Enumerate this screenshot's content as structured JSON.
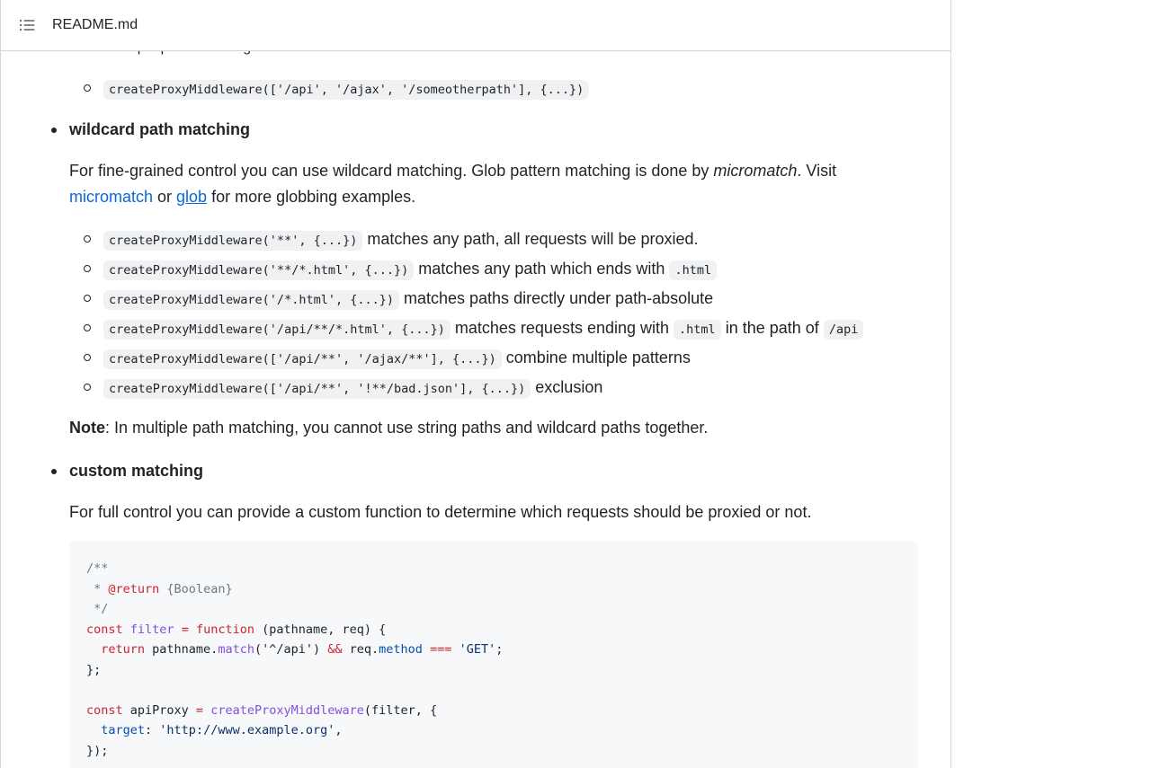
{
  "header": {
    "file_name": "README.md",
    "toc_icon": "list-unordered-icon"
  },
  "top_partial": {
    "text": "multiple path matching"
  },
  "top_item": {
    "code": "createProxyMiddleware(['/api', '/ajax', '/someotherpath'], {...})"
  },
  "wildcard": {
    "heading": "wildcard path matching",
    "para_part1": "For fine-grained control you can use wildcard matching. Glob pattern matching is done by ",
    "para_em": "micromatch",
    "para_part2": ". Visit",
    "link_micromatch": "micromatch",
    "para_or": " or ",
    "link_glob": "glob",
    "para_part3": " for more globbing examples.",
    "items": [
      {
        "code": "createProxyMiddleware('**', {...})",
        "text": "matches any path, all requests will be proxied."
      },
      {
        "code": "createProxyMiddleware('**/*.html', {...})",
        "text": "matches any path which ends with",
        "code2": ".html"
      },
      {
        "code": "createProxyMiddleware('/*.html', {...})",
        "text": "matches paths directly under path-absolute"
      },
      {
        "code": "createProxyMiddleware('/api/**/*.html', {...})",
        "text": "matches requests ending with",
        "code2": ".html",
        "text2": "in the path of",
        "code3": "/api"
      },
      {
        "code": "createProxyMiddleware(['/api/**', '/ajax/**'], {...})",
        "text": "combine multiple patterns"
      },
      {
        "code": "createProxyMiddleware(['/api/**', '!**/bad.json'], {...})",
        "text": "exclusion"
      }
    ],
    "note_label": "Note",
    "note_text": ": In multiple path matching, you cannot use string paths and wildcard paths together."
  },
  "custom": {
    "heading": "custom matching",
    "para": "For full control you can provide a custom function to determine which requests should be proxied or not."
  },
  "code_block": {
    "l1": "/**",
    "l2a": " * ",
    "l2b": "@return",
    "l2c": " {Boolean}",
    "l3": " */",
    "l4a": "const",
    "l4b": "filter",
    "l4c": "=",
    "l4d": "function",
    "l4e": " (pathname, req) {",
    "l5a": "  return",
    "l5b": " pathname.",
    "l5c": "match",
    "l5d": "('^/api') ",
    "l5e": "&&",
    "l5f": " req.",
    "l5g": "method",
    "l5h": "===",
    "l5i": "'GET'",
    "l5j": ";",
    "l6": "};",
    "l8a": "const",
    "l8b": " apiProxy ",
    "l8c": "=",
    "l8d": "createProxyMiddleware",
    "l8e": "(filter, {",
    "l9a": "  target",
    "l9b": ": ",
    "l9c": "'http://www.example.org'",
    "l9d": ",",
    "l10": "});"
  },
  "colors": {
    "link": "#0969da",
    "code_bg": "#eff1f3",
    "block_bg": "#f6f8fa",
    "keyword": "#cf222e",
    "function": "#8250df",
    "property": "#0550ae",
    "comment": "#6e7781"
  }
}
